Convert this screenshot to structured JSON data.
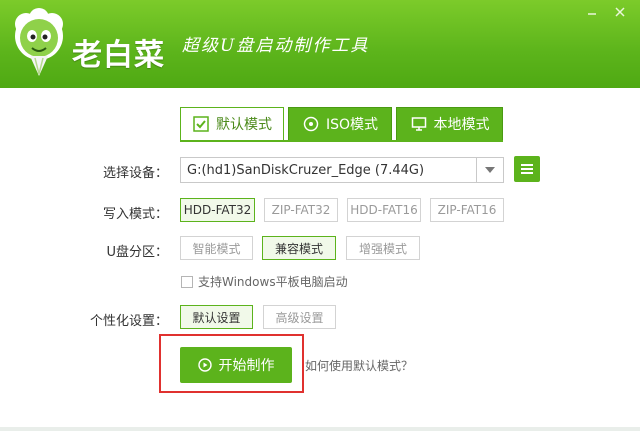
{
  "header": {
    "title": "老白菜",
    "slogan": "超级U盘启动制作工具"
  },
  "tabs": [
    {
      "label": "默认模式",
      "icon": "checkmark-icon"
    },
    {
      "label": "ISO模式",
      "icon": "disc-icon"
    },
    {
      "label": "本地模式",
      "icon": "monitor-icon"
    }
  ],
  "device": {
    "label": "选择设备：",
    "value": "G:(hd1)SanDiskCruzer_Edge (7.44G)"
  },
  "write_mode": {
    "label": "写入模式：",
    "options": [
      "HDD-FAT32",
      "ZIP-FAT32",
      "HDD-FAT16",
      "ZIP-FAT16"
    ],
    "selected": "HDD-FAT32"
  },
  "partition": {
    "label": "U盘分区：",
    "options": [
      "智能模式",
      "兼容模式",
      "增强模式"
    ],
    "selected": "兼容模式"
  },
  "windows_tablet": {
    "label": "支持Windows平板电脑启动",
    "checked": false
  },
  "personalize": {
    "label": "个性化设置：",
    "options": [
      "默认设置",
      "高级设置"
    ],
    "selected": "默认设置"
  },
  "start_button": "开始制作",
  "help_link": "如何使用默认模式？",
  "colors": {
    "accent": "#5cb31c",
    "highlight": "#e0312f"
  }
}
